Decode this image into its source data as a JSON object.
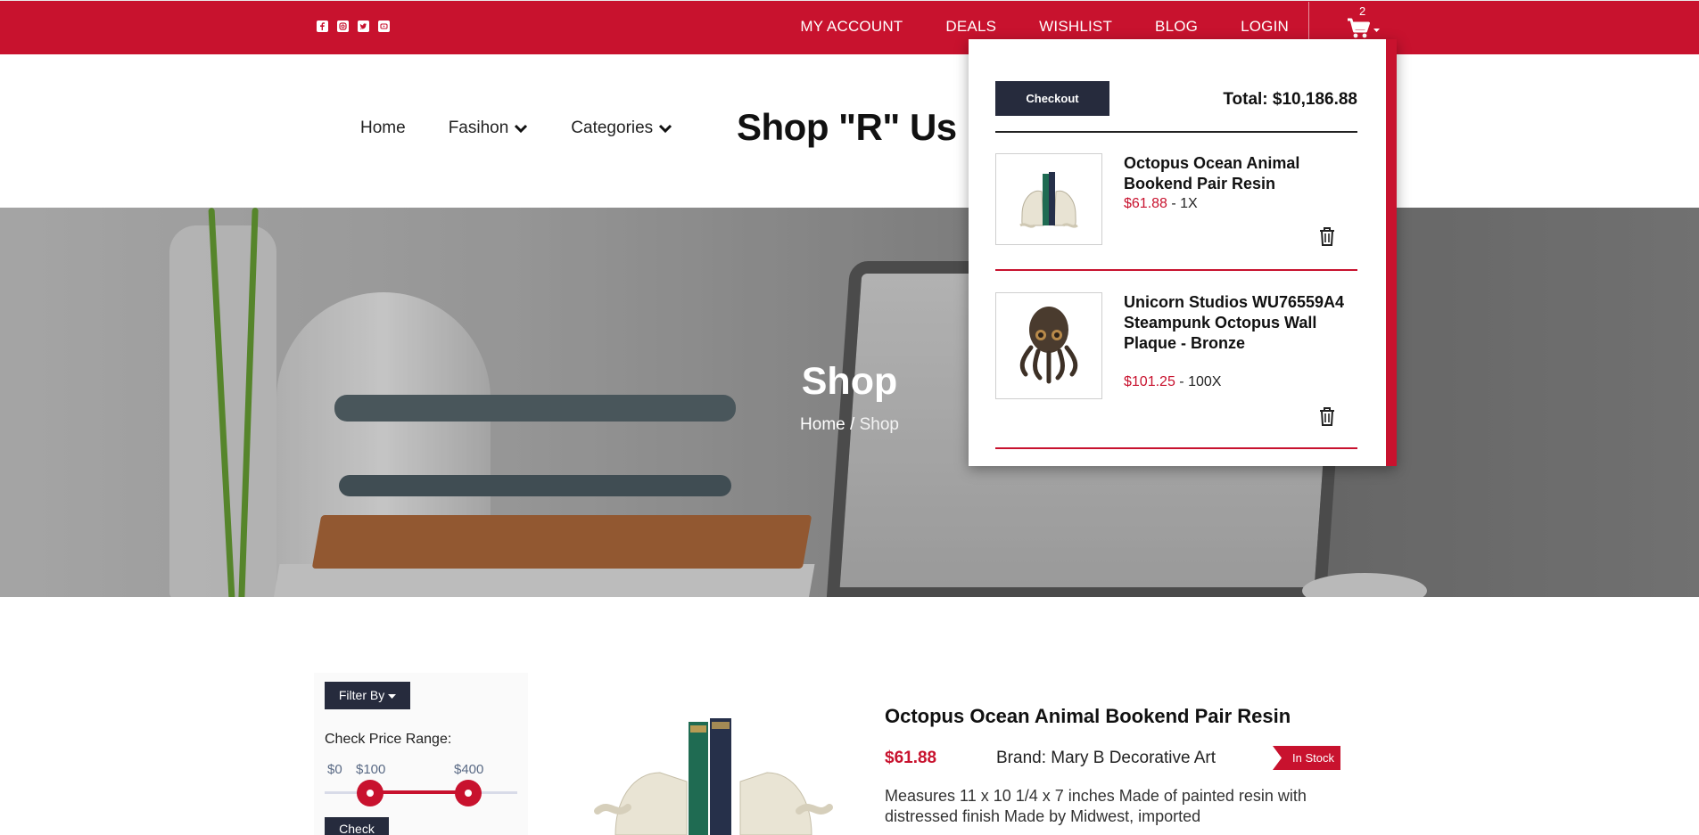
{
  "topbar": {
    "social": [
      "facebook-icon",
      "instagram-icon",
      "twitter-icon",
      "youtube-icon"
    ],
    "nav": [
      "MY ACCOUNT",
      "DEALS",
      "WISHLIST",
      "BLOG",
      "LOGIN"
    ],
    "cart_count": "2"
  },
  "header": {
    "nav": [
      {
        "label": "Home",
        "dropdown": false
      },
      {
        "label": "Fasihon",
        "dropdown": true
      },
      {
        "label": "Categories",
        "dropdown": true
      }
    ],
    "brand": "Shop \"R\" Us"
  },
  "hero": {
    "title": "Shop",
    "breadcrumb": {
      "home": "Home",
      "sep": " / ",
      "current": "Shop"
    }
  },
  "cart_dropdown": {
    "checkout_label": "Checkout",
    "total": "Total: $10,186.88",
    "items": [
      {
        "name": "Octopus Ocean Animal Bookend Pair Resin",
        "price": "$61.88",
        "qty": " - 1X"
      },
      {
        "name": "Unicorn Studios WU76559A4 Steampunk Octopus Wall Plaque - Bronze",
        "price": "$101.25",
        "qty": " - 100X"
      }
    ]
  },
  "filter": {
    "button": "Filter By",
    "range_label": "Check Price Range:",
    "min_label": "$0",
    "low_label": "$100",
    "high_label": "$400",
    "check_button": "Check"
  },
  "product": {
    "title": "Octopus Ocean Animal Bookend Pair Resin",
    "price": "$61.88",
    "brand": "Brand: Mary B Decorative Art",
    "stock": "In Stock",
    "description": "Measures 11 x 10 1/4 x 7 inches Made of painted resin with distressed finish Made by Midwest, imported"
  },
  "colors": {
    "accent": "#c8122e",
    "dark": "#262b3d"
  }
}
